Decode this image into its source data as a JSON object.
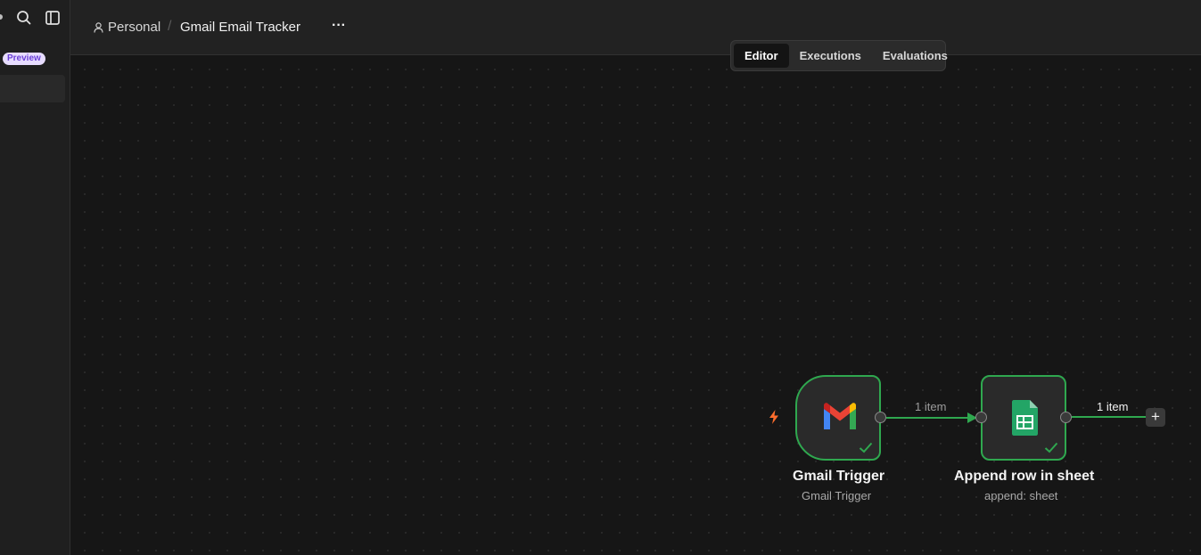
{
  "sidebar": {
    "preview_badge": "Preview",
    "search_icon": "search-icon",
    "panel_icon": "sidebar-toggle-icon"
  },
  "header": {
    "breadcrumb": {
      "project": "Personal",
      "separator": "/",
      "workflow_name": "Gmail Email Tracker"
    },
    "more_label": "···"
  },
  "tabs": [
    {
      "label": "Editor",
      "active": true
    },
    {
      "label": "Executions",
      "active": false
    },
    {
      "label": "Evaluations",
      "active": false
    }
  ],
  "nodes": [
    {
      "title": "Gmail Trigger",
      "subtitle": "Gmail Trigger",
      "icon": "gmail-icon",
      "status": "success"
    },
    {
      "title": "Append row in sheet",
      "subtitle": "append: sheet",
      "icon": "google-sheets-icon",
      "status": "success"
    }
  ],
  "edges": [
    {
      "label": "1 item"
    },
    {
      "label": "1 item"
    }
  ],
  "add_button_label": "+",
  "colors": {
    "success": "#2fa84f",
    "trigger_bolt": "#ff6d2d",
    "preview_badge_bg": "#e7dcff",
    "preview_badge_text": "#6b3fd6",
    "canvas": "#161616"
  }
}
